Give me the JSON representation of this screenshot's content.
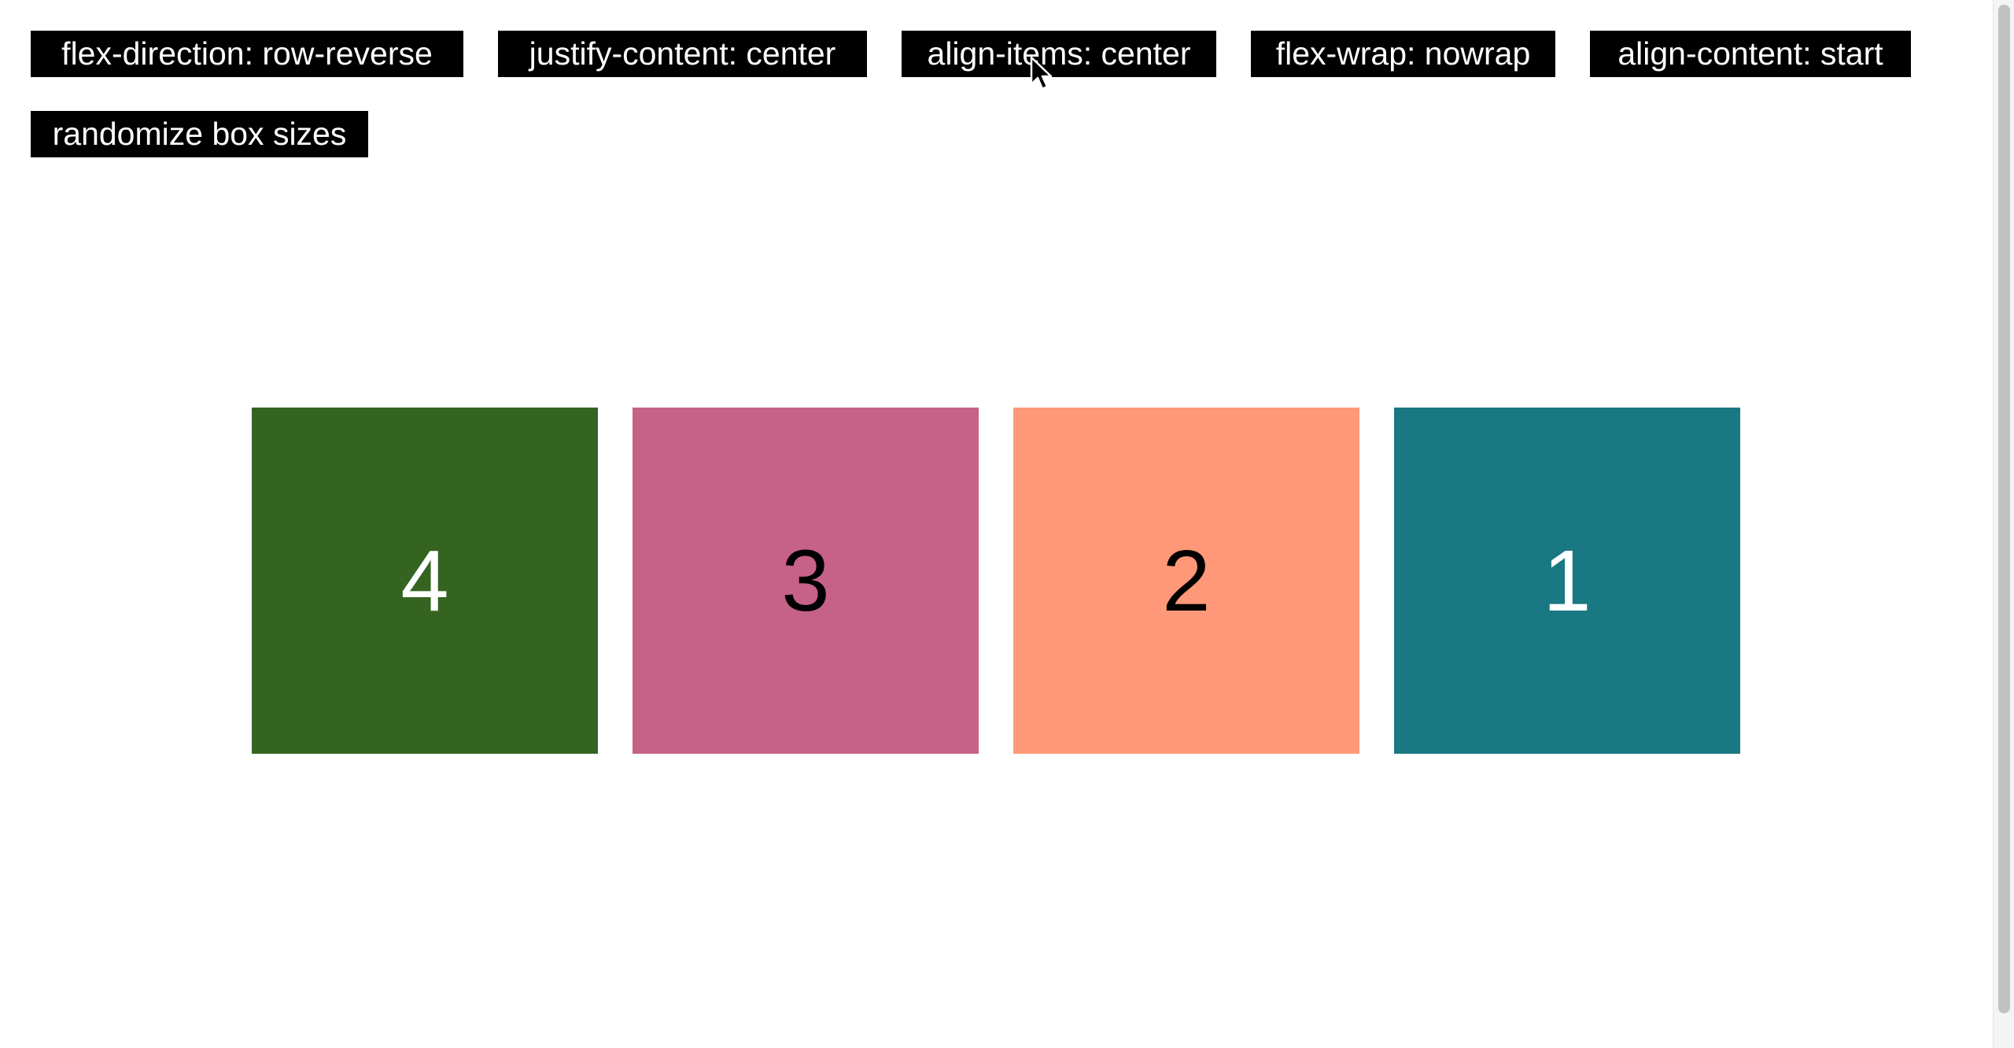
{
  "controls": {
    "flex_direction": "flex-direction: row-reverse",
    "justify_content": "justify-content: center",
    "align_items": "align-items: center",
    "flex_wrap": "flex-wrap: nowrap",
    "align_content": "align-content: start",
    "randomize": "randomize box sizes"
  },
  "boxes": [
    {
      "label": "4",
      "color": "#356421",
      "text_color": "#ffffff"
    },
    {
      "label": "3",
      "color": "#c66188",
      "text_color": "#000000"
    },
    {
      "label": "2",
      "color": "#fe9878",
      "text_color": "#000000"
    },
    {
      "label": "1",
      "color": "#1a7882",
      "text_color": "#ffffff"
    }
  ],
  "icons": {
    "cursor": "mouse-pointer-icon"
  }
}
